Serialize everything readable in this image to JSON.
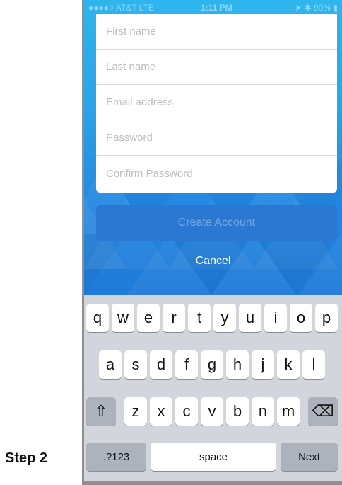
{
  "status": {
    "carrier": "●●●●○ AT&T  LTE",
    "time": "1:11 PM",
    "right": "➤ ✱ 90% ▮"
  },
  "form": {
    "fields": [
      {
        "placeholder": "First name"
      },
      {
        "placeholder": "Last name"
      },
      {
        "placeholder": "Email address"
      },
      {
        "placeholder": "Password"
      },
      {
        "placeholder": "Confirm Password"
      }
    ],
    "create_label": "Create Account",
    "cancel_label": "Cancel"
  },
  "keyboard": {
    "row1": [
      "q",
      "w",
      "e",
      "r",
      "t",
      "y",
      "u",
      "i",
      "o",
      "p"
    ],
    "row2": [
      "a",
      "s",
      "d",
      "f",
      "g",
      "h",
      "j",
      "k",
      "l"
    ],
    "row3": [
      "z",
      "x",
      "c",
      "v",
      "b",
      "n",
      "m"
    ],
    "shift_icon": "⇧",
    "delete_icon": "⌫",
    "numbers_label": ".?123",
    "space_label": "space",
    "next_label": "Next"
  },
  "caption": "Step 2"
}
